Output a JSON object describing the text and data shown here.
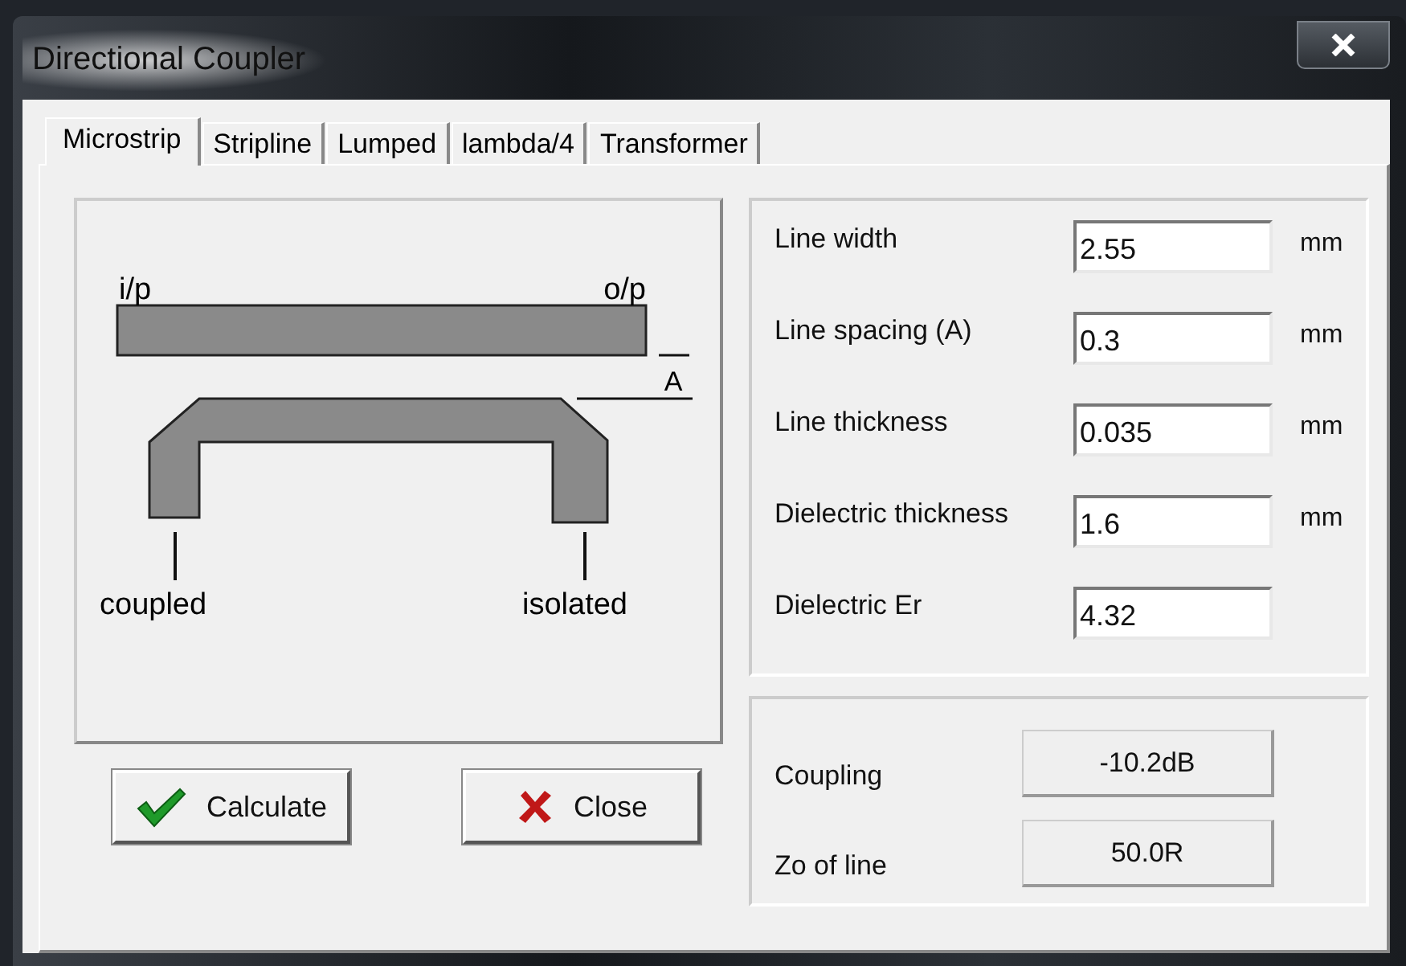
{
  "window": {
    "title": "Directional Coupler"
  },
  "tabs": [
    {
      "label": "Microstrip",
      "selected": true
    },
    {
      "label": "Stripline",
      "selected": false
    },
    {
      "label": "Lumped",
      "selected": false
    },
    {
      "label": "lambda/4",
      "selected": false
    },
    {
      "label": "Transformer",
      "selected": false
    }
  ],
  "diagram": {
    "input_label": "i/p",
    "output_label": "o/p",
    "spacing_label": "A",
    "coupled_label": "coupled",
    "isolated_label": "isolated"
  },
  "inputs": [
    {
      "label": "Line width",
      "value": "2.55",
      "unit": "mm"
    },
    {
      "label": "Line spacing (A)",
      "value": "0.3",
      "unit": "mm"
    },
    {
      "label": "Line thickness",
      "value": "0.035",
      "unit": "mm"
    },
    {
      "label": "Dielectric thickness",
      "value": "1.6",
      "unit": "mm"
    },
    {
      "label": "Dielectric Er",
      "value": "4.32"
    }
  ],
  "results": [
    {
      "label": "Coupling",
      "value": "-10.2dB"
    },
    {
      "label": "Zo of line",
      "value": "50.0R"
    }
  ],
  "buttons": [
    {
      "label": "Calculate",
      "kind": "ok"
    },
    {
      "label": "Close",
      "kind": "cancel"
    }
  ]
}
